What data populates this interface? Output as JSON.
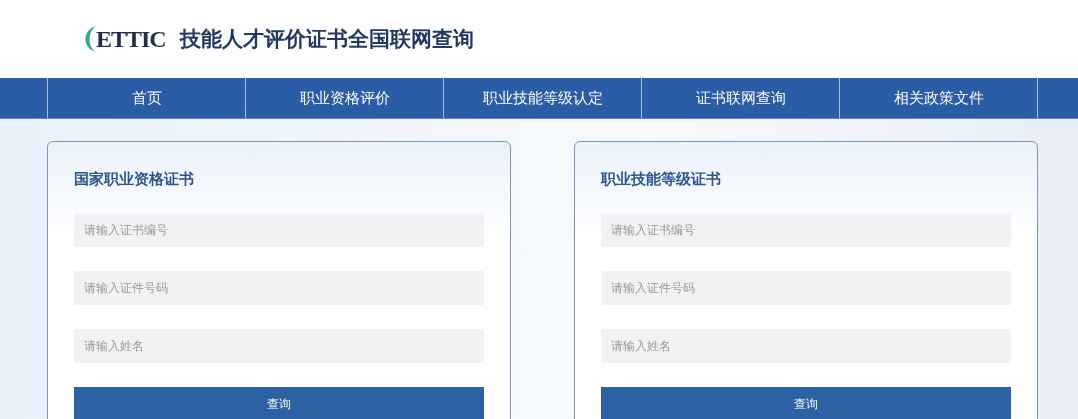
{
  "header": {
    "logo_text": "ETTIC",
    "title": "技能人才评价证书全国联网查询"
  },
  "nav": [
    {
      "label": "首页"
    },
    {
      "label": "职业资格评价"
    },
    {
      "label": "职业技能等级认定"
    },
    {
      "label": "证书联网查询"
    },
    {
      "label": "相关政策文件"
    }
  ],
  "cards": [
    {
      "title": "国家职业资格证书",
      "fields": [
        {
          "placeholder": "请输入证书编号"
        },
        {
          "placeholder": "请输入证件号码"
        },
        {
          "placeholder": "请输入姓名"
        }
      ],
      "button": "查询"
    },
    {
      "title": "职业技能等级证书",
      "fields": [
        {
          "placeholder": "请输入证书编号"
        },
        {
          "placeholder": "请输入证件号码"
        },
        {
          "placeholder": "请输入姓名"
        }
      ],
      "button": "查询"
    }
  ]
}
